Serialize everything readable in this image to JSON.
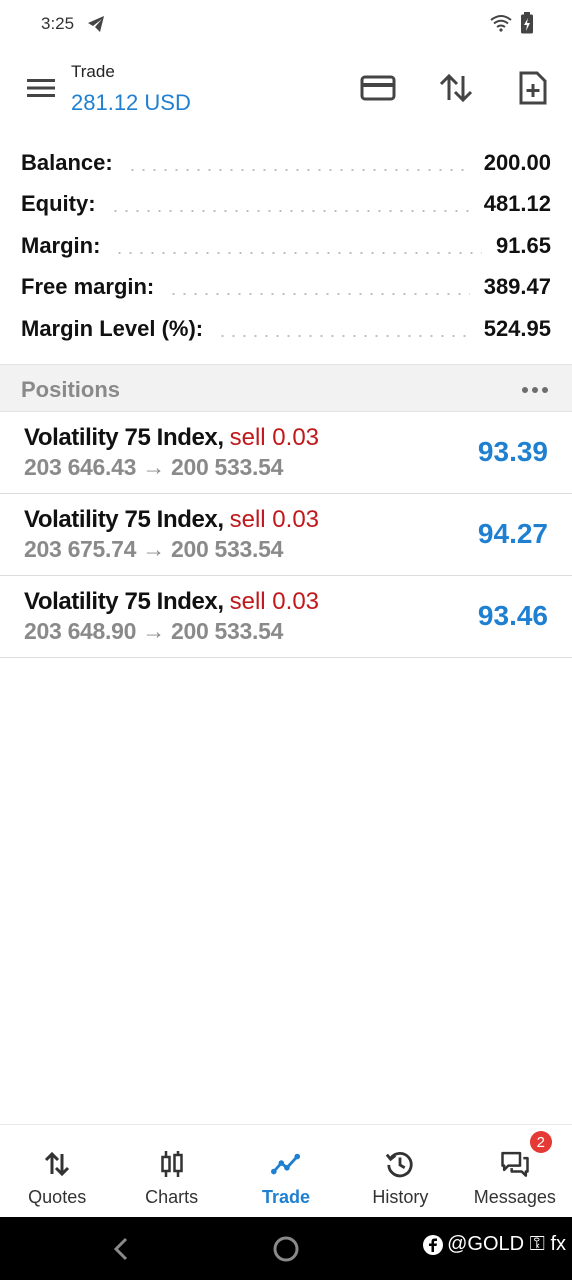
{
  "status": {
    "time": "3:25"
  },
  "header": {
    "title": "Trade",
    "balance": "281.12 USD"
  },
  "summary": [
    {
      "label": "Balance:",
      "value": "200.00"
    },
    {
      "label": "Equity:",
      "value": "481.12"
    },
    {
      "label": "Margin:",
      "value": "91.65"
    },
    {
      "label": "Free margin:",
      "value": "389.47"
    },
    {
      "label": "Margin Level (%):",
      "value": "524.95"
    }
  ],
  "positions": {
    "title": "Positions",
    "items": [
      {
        "symbol": "Volatility 75 Index,",
        "type": "sell 0.03",
        "prices": "203 646.43 → 200 533.54",
        "profit": "93.39"
      },
      {
        "symbol": "Volatility 75 Index,",
        "type": "sell 0.03",
        "prices": "203 675.74 → 200 533.54",
        "profit": "94.27"
      },
      {
        "symbol": "Volatility 75 Index,",
        "type": "sell 0.03",
        "prices": "203 648.90 → 200 533.54",
        "profit": "93.46"
      }
    ]
  },
  "nav": {
    "items": [
      {
        "label": "Quotes",
        "icon": "quotes-icon"
      },
      {
        "label": "Charts",
        "icon": "charts-icon"
      },
      {
        "label": "Trade",
        "icon": "trade-icon",
        "active": true
      },
      {
        "label": "History",
        "icon": "history-icon"
      },
      {
        "label": "Messages",
        "icon": "messages-icon",
        "badge": "2"
      }
    ]
  },
  "watermark": "@GOLD ⚿ fx",
  "colors": {
    "accent": "#1f80d2",
    "sell": "#c0181b",
    "badge": "#e53935"
  }
}
